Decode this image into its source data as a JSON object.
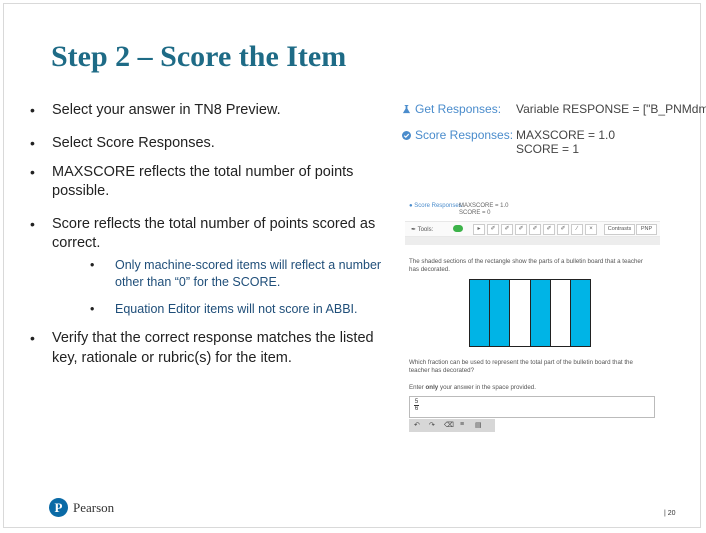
{
  "slide": {
    "title": "Step 2 – Score the Item",
    "bullets": [
      "Select your answer in TN8 Preview.",
      "Select Score Responses.",
      "MAXSCORE reflects the total number of points possible.",
      "Score reflects the total number of points scored as correct.",
      "Verify that the correct response matches the listed key, rationale or rubric(s) for the item."
    ],
    "sub_bullets": [
      "Only machine-scored items will reflect a number other than “0” for the SCORE.",
      "Equation Editor items will not score in ABBI."
    ],
    "page_number": "20",
    "logo_text": "Pearson",
    "logo_letter": "P"
  },
  "responses": {
    "get_label": "Get Responses:",
    "get_value": "Variable RESPONSE = [\"B_PNMdm\"]",
    "score_label": "Score Responses:",
    "score_max": "MAXSCORE = 1.0",
    "score_value": "SCORE = 1"
  },
  "preview": {
    "score_label": "Score Responses:",
    "score_max": "MAXSCORE = 1.0",
    "score_value": "SCORE = 0",
    "tools_label": "Tools:",
    "tool_glyphs": [
      "▸",
      "✐",
      "✐",
      "✐",
      "✐",
      "✐",
      "✐",
      "∕",
      "×"
    ],
    "contrasts_label": "Contrasts",
    "pnp_label": "PNP",
    "question_1": "The shaded sections of the rectangle show the parts of a bulletin board that a teacher has decorated.",
    "question_2": "Which fraction can be used to represent the total part of the bulletin board that the teacher has decorated?",
    "instruction_pre": "Enter ",
    "instruction_bold": "only",
    "instruction_post": " your answer in the space provided.",
    "answer_num": "5",
    "answer_den": "6",
    "bar_fills": [
      true,
      true,
      false,
      true,
      false,
      true
    ],
    "shade_color": "#00b4e6",
    "editor_glyphs": [
      "↶",
      "↷",
      "⌫",
      "≡",
      "▤"
    ]
  },
  "colors": {
    "title": "#1e6b86",
    "sub_text": "#1f4e79",
    "link": "#4a8ccc",
    "logo": "#0a6aa6"
  }
}
